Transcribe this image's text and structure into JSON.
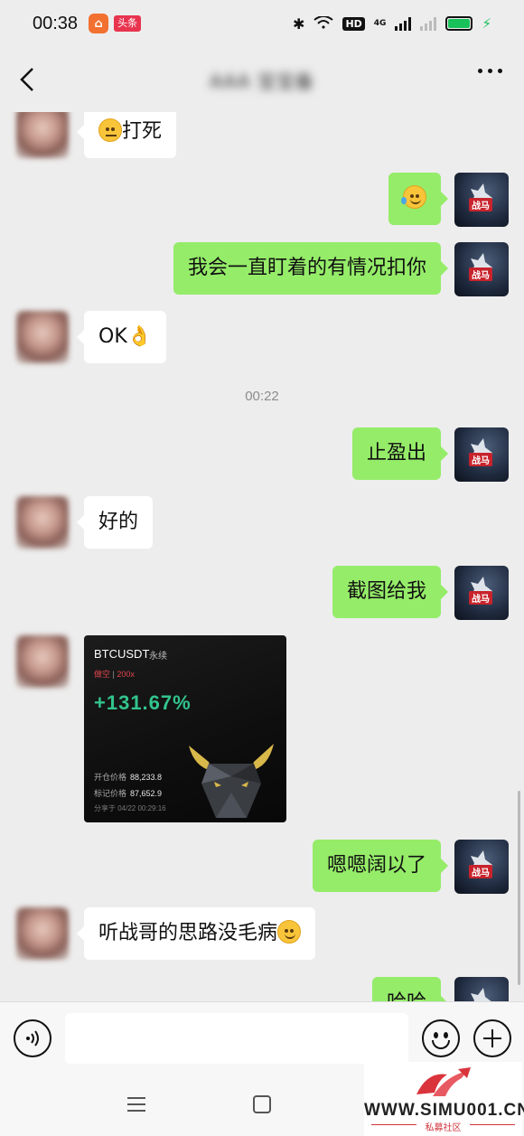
{
  "status_bar": {
    "time": "00:38",
    "app_badge": "",
    "news_badge": "头条",
    "hd_label": "HD",
    "network": "4G"
  },
  "header": {
    "title": "AAA 宝宝备"
  },
  "messages": [
    {
      "side": "left",
      "text": "打死",
      "emoji": "thinking-face"
    },
    {
      "side": "right",
      "text": "",
      "emoji": "laughing-tears-face"
    },
    {
      "side": "right",
      "text": "我会一直盯着的有情况扣你"
    },
    {
      "side": "left",
      "text": "OK",
      "emoji": "ok-hand"
    },
    {
      "type": "time",
      "text": "00:22"
    },
    {
      "side": "right",
      "text": "止盈出"
    },
    {
      "side": "left",
      "text": "好的"
    },
    {
      "side": "right",
      "text": "截图给我"
    },
    {
      "side": "left",
      "type": "image"
    },
    {
      "side": "right",
      "text": "嗯嗯阔以了"
    },
    {
      "side": "left",
      "text": "听战哥的思路没毛病",
      "emoji": "smiling-face"
    },
    {
      "side": "right",
      "text": "哈哈"
    }
  ],
  "avatar_right_tag": "战马",
  "trade_card": {
    "symbol": "BTCUSDT",
    "contract_type": "永续",
    "side": "做空",
    "leverage": "200x",
    "pnl": "+131.67%",
    "open_label": "开仓价格",
    "open_price": "88,233.8",
    "mark_label": "标记价格",
    "mark_price": "87,652.9",
    "share_label": "分享于",
    "share_time": "04/22 00:29:16"
  },
  "input": {
    "value": "",
    "placeholder": ""
  },
  "watermark": {
    "url": "WWW.SIMU001.CN",
    "subtitle": "私募社区"
  },
  "colors": {
    "sent_bubble": "#95ec69",
    "received_bubble": "#ffffff",
    "background": "#ededed",
    "pnl_green": "#32c48d",
    "short_red": "#e0464e"
  }
}
